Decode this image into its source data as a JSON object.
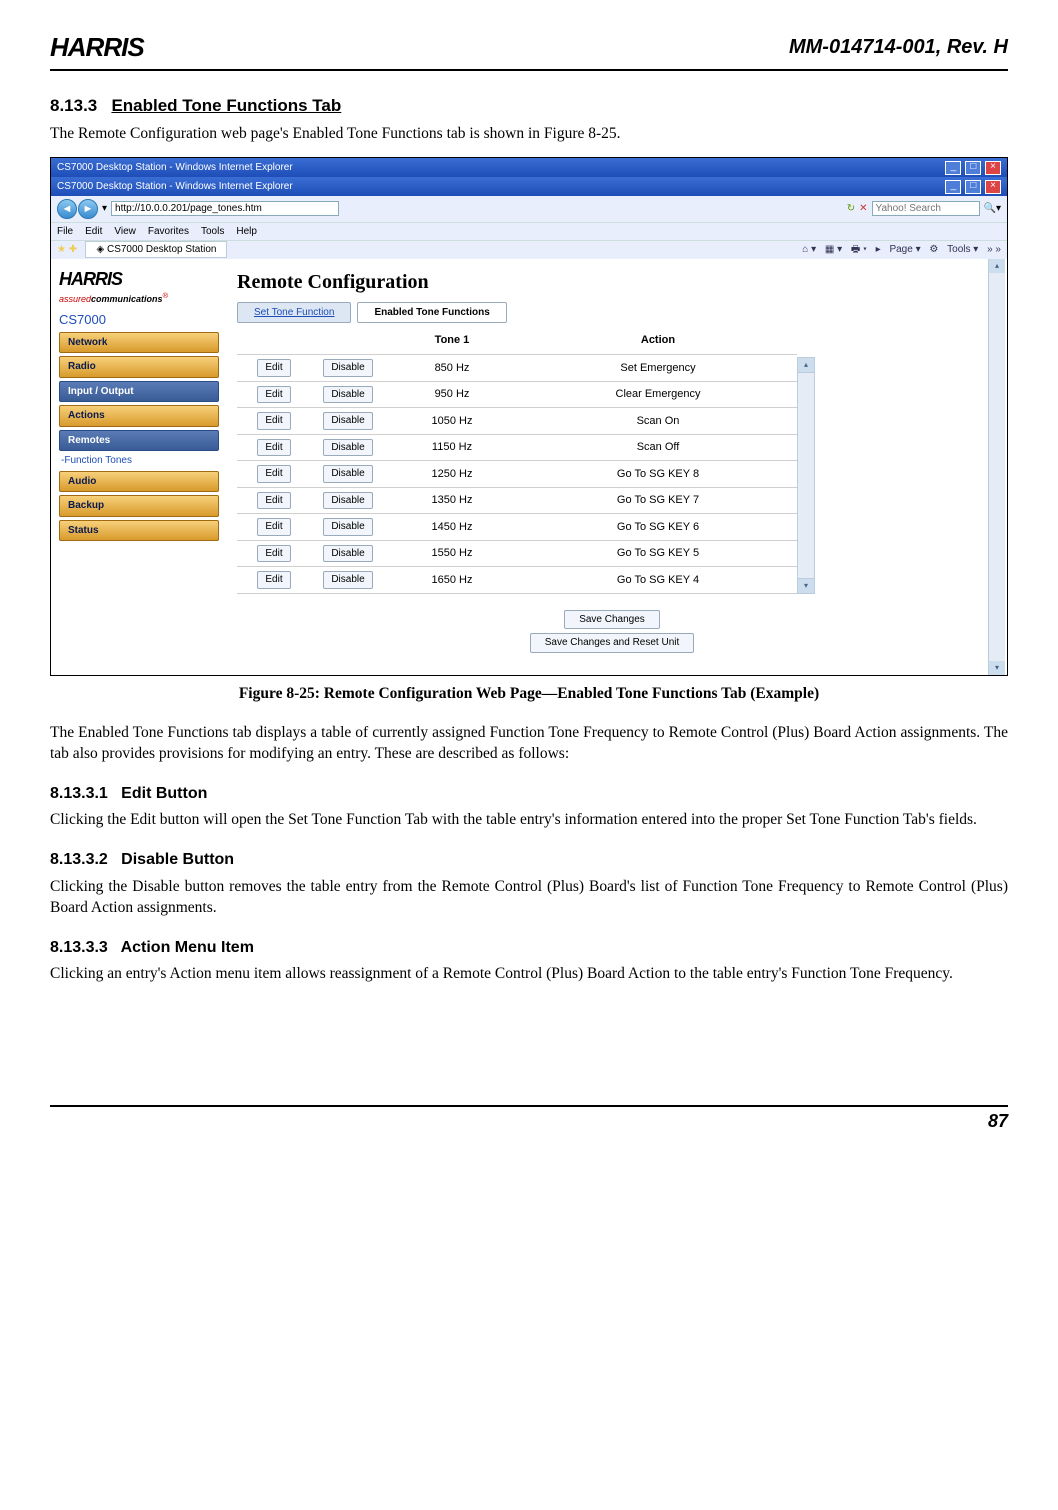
{
  "header": {
    "logo": "HARRIS",
    "doc_id": "MM-014714-001, Rev. H"
  },
  "section": {
    "number": "8.13.3",
    "title": "Enabled Tone Functions Tab",
    "intro": "The Remote Configuration web page's Enabled Tone Functions tab is shown in Figure 8-25."
  },
  "screenshot": {
    "window_title": "CS7000 Desktop Station - Windows Internet Explorer",
    "url": "http://10.0.0.201/page_tones.htm",
    "menu": [
      "File",
      "Edit",
      "View",
      "Favorites",
      "Tools",
      "Help"
    ],
    "tab_label": "CS7000 Desktop Station",
    "search_label": "Yahoo! Search",
    "toolbar_items": [
      "Page",
      "Tools"
    ],
    "brand": "HARRIS",
    "tagline_red": "assured",
    "tagline_black": "communications",
    "product": "CS7000",
    "nav": [
      {
        "label": "Network",
        "sel": false
      },
      {
        "label": "Radio",
        "sel": false
      },
      {
        "label": "Input / Output",
        "sel": true
      },
      {
        "label": "Actions",
        "sel": false
      },
      {
        "label": "Remotes",
        "sel": true
      }
    ],
    "nav_sub": "-Function Tones",
    "nav2": [
      {
        "label": "Audio"
      },
      {
        "label": "Backup"
      },
      {
        "label": "Status"
      }
    ],
    "page_title": "Remote Configuration",
    "tabs": [
      {
        "label": "Set Tone Function",
        "active": false
      },
      {
        "label": "Enabled Tone Functions",
        "active": true
      }
    ],
    "col_tone": "Tone 1",
    "col_action": "Action",
    "edit_btn": "Edit",
    "disable_btn": "Disable",
    "rows": [
      {
        "tone": "850 Hz",
        "action": "Set Emergency"
      },
      {
        "tone": "950 Hz",
        "action": "Clear Emergency"
      },
      {
        "tone": "1050 Hz",
        "action": "Scan On"
      },
      {
        "tone": "1150 Hz",
        "action": "Scan Off"
      },
      {
        "tone": "1250 Hz",
        "action": "Go To SG KEY 8"
      },
      {
        "tone": "1350 Hz",
        "action": "Go To SG KEY 7"
      },
      {
        "tone": "1450 Hz",
        "action": "Go To SG KEY 6"
      },
      {
        "tone": "1550 Hz",
        "action": "Go To SG KEY 5"
      },
      {
        "tone": "1650 Hz",
        "action": "Go To SG KEY 4"
      }
    ],
    "save_changes": "Save Changes",
    "save_reset": "Save Changes and Reset Unit"
  },
  "figure_caption": "Figure 8-25:  Remote Configuration Web Page—Enabled Tone Functions Tab (Example)",
  "para2": "The Enabled Tone Functions tab displays a table of currently assigned Function Tone Frequency to Remote Control (Plus) Board Action assignments.  The tab also provides provisions for modifying an entry.  These are described as follows:",
  "sub1": {
    "num": "8.13.3.1",
    "title": "Edit Button",
    "text": "Clicking the Edit button will open the Set Tone Function Tab with the table entry's information entered into the proper Set Tone Function Tab's fields."
  },
  "sub2": {
    "num": "8.13.3.2",
    "title": "Disable Button",
    "text": "Clicking the Disable button removes the table entry from the Remote Control (Plus) Board's list of Function Tone Frequency to Remote Control (Plus) Board Action assignments."
  },
  "sub3": {
    "num": "8.13.3.3",
    "title": "Action Menu Item",
    "text": "Clicking an entry's Action menu item allows reassignment of a Remote Control (Plus) Board Action to the table entry's Function Tone Frequency."
  },
  "page_number": "87"
}
